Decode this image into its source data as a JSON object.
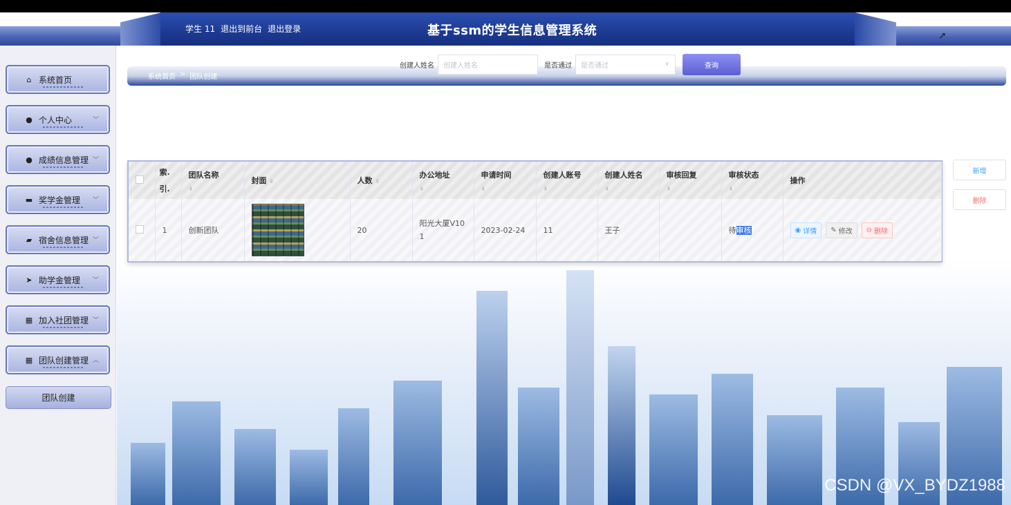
{
  "header": {
    "user_label": "学生 11",
    "back_link": "退出到前台",
    "logout_link": "退出登录",
    "title": "基于ssm的学生信息管理系统"
  },
  "sidebar": {
    "items": [
      {
        "label": "系统首页",
        "icon": "home-icon"
      },
      {
        "label": "个人中心",
        "icon": "user-icon",
        "chevron": "﹀"
      },
      {
        "label": "成绩信息管理",
        "icon": "user-icon",
        "chevron": "﹀"
      },
      {
        "label": "奖学金管理",
        "icon": "card-icon",
        "chevron": "﹀"
      },
      {
        "label": "宿舍信息管理",
        "icon": "chat-icon",
        "chevron": "﹀"
      },
      {
        "label": "助学金管理",
        "icon": "send-icon",
        "chevron": "﹀"
      },
      {
        "label": "加入社团管理",
        "icon": "grid-icon",
        "chevron": "﹀"
      },
      {
        "label": "团队创建管理",
        "icon": "grid-icon",
        "chevron": "︿"
      }
    ],
    "submenu_label": "团队创建"
  },
  "breadcrumb": {
    "home": "系统首页",
    "sep": ">",
    "current": "团队创建"
  },
  "search": {
    "creator_label": "创建人姓名",
    "creator_placeholder": "创建人姓名",
    "approved_label": "是否通过",
    "approved_placeholder": "是否通过",
    "query_button": "查询"
  },
  "actions": {
    "add": "新增",
    "delete": "删除"
  },
  "table": {
    "headers": [
      "索引",
      "团队名称",
      "封面",
      "人数",
      "办公地址",
      "申请时间",
      "创建人账号",
      "创建人姓名",
      "审核回复",
      "审核状态",
      "操作"
    ],
    "header_index_line1": "索.",
    "header_index_line2": "引.",
    "rows": [
      {
        "index": "1",
        "team_name": "创新团队",
        "members": "20",
        "address_line1": "阳光大厦V10",
        "address_line2": "1",
        "apply_date": "2023-02-24",
        "creator_account": "11",
        "creator_name": "王子",
        "review_reply": "",
        "status_prefix": "待",
        "status_highlight": "审核",
        "op_detail": "详情",
        "op_edit": "修改",
        "op_delete": "删除"
      }
    ]
  },
  "watermark": "CSDN @VX_BYDZ1988",
  "colors": {
    "accent": "#2c4fb0",
    "query_button": "#6f72e0",
    "delete": "#f56c6c",
    "detail": "#409eff"
  }
}
